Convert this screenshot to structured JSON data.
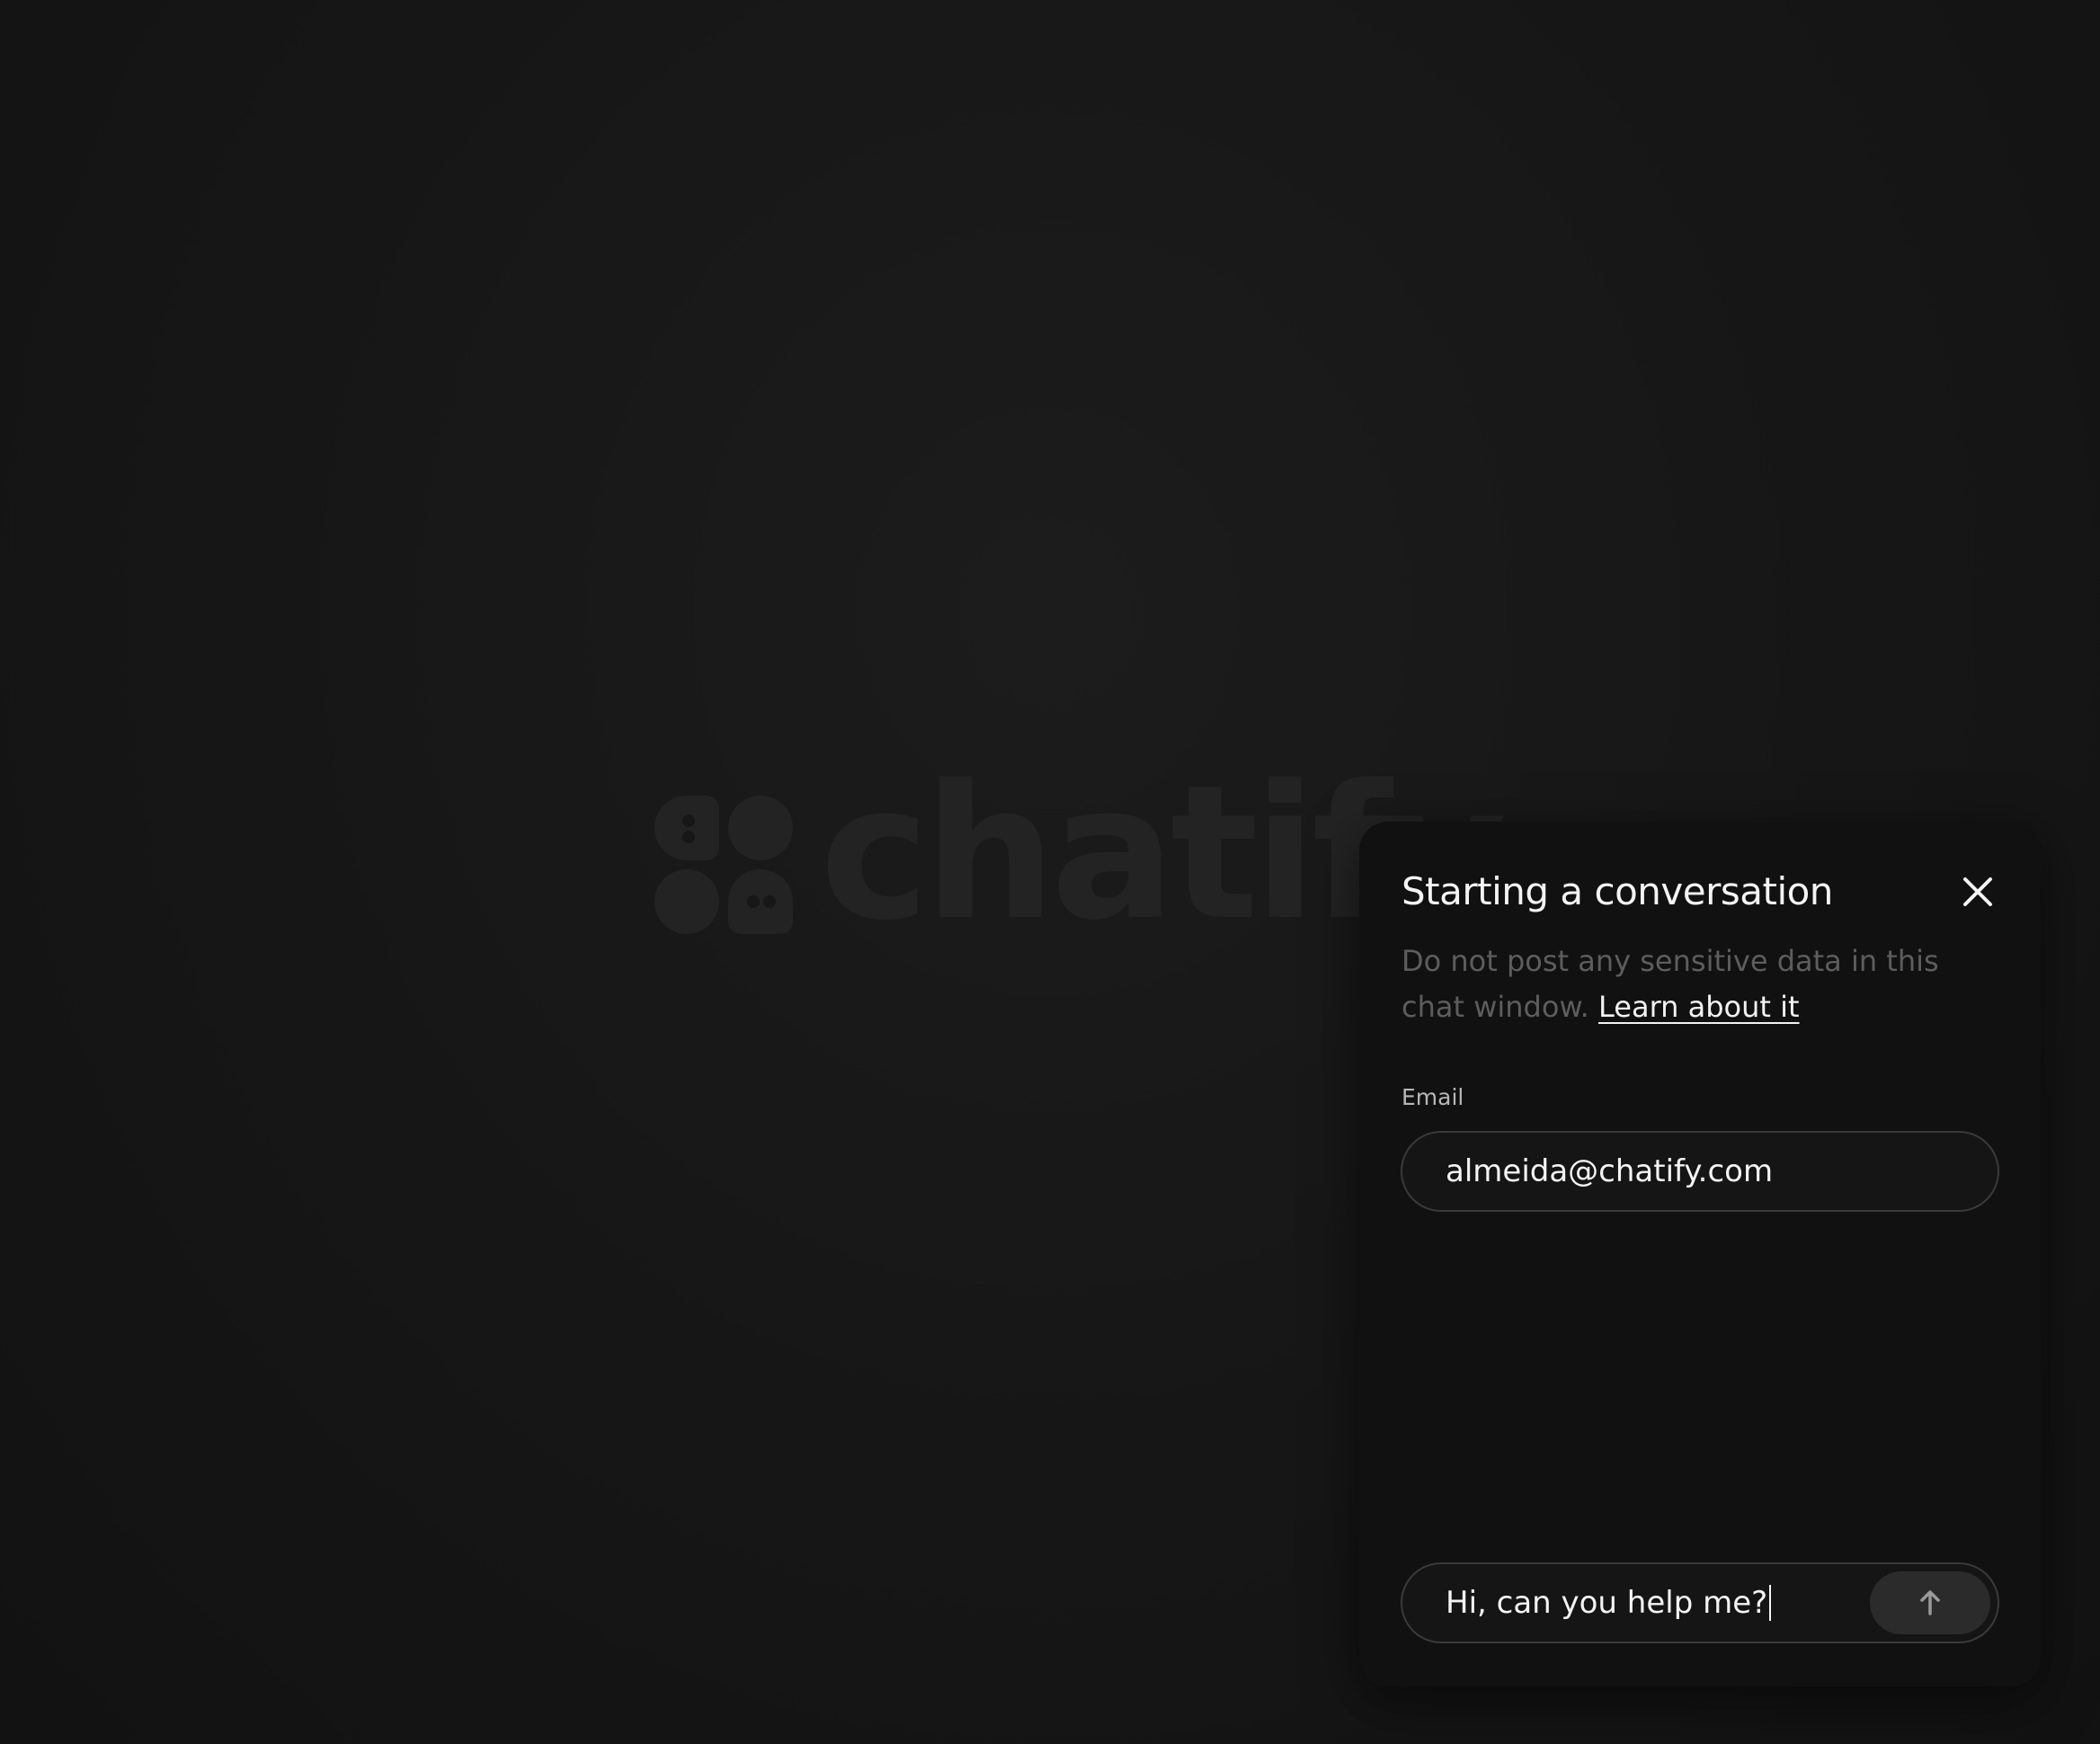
{
  "brand": {
    "wordmark": "chatify"
  },
  "chat": {
    "title": "Starting a conversation",
    "notice_text": "Do not post any sensitive data in this chat window.",
    "notice_link": "Learn about it",
    "email_label": "Email",
    "email_value": "almeida@chatify.com",
    "message_value": "Hi, can you help me?"
  },
  "icons": {
    "close": "close-icon",
    "send": "arrow-up-icon",
    "logo": "chatify-logo-mark"
  },
  "colors": {
    "background": "#171717",
    "panel": "#111111",
    "text_primary": "#f4f4f4",
    "text_muted": "#5d5d5d",
    "watermark": "#232323",
    "send_button": "#2b2b2b"
  }
}
